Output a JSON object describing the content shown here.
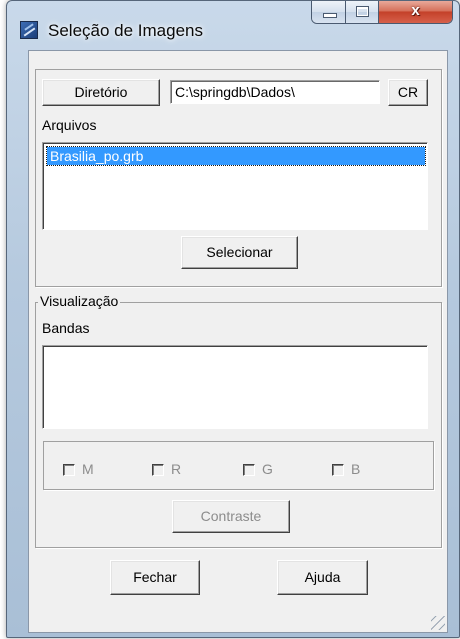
{
  "window": {
    "title": "Seleção de Imagens",
    "close_glyph": "x"
  },
  "directory": {
    "button_label": "Diretório",
    "path_value": "C:\\springdb\\Dados\\",
    "cr_button_label": "CR"
  },
  "files": {
    "label": "Arquivos",
    "items": [
      "Brasilia_po.grb"
    ],
    "selected_index": 0,
    "select_button_label": "Selecionar"
  },
  "visualization": {
    "group_label": "Visualização",
    "bands_label": "Bandas",
    "bands_items": [],
    "channels": [
      {
        "label": "M",
        "checked": false,
        "enabled": false
      },
      {
        "label": "R",
        "checked": false,
        "enabled": false
      },
      {
        "label": "G",
        "checked": false,
        "enabled": false
      },
      {
        "label": "B",
        "checked": false,
        "enabled": false
      }
    ],
    "contrast_button_label": "Contraste",
    "contrast_enabled": false
  },
  "footer": {
    "close_button_label": "Fechar",
    "help_button_label": "Ajuda"
  },
  "colors": {
    "selection_bg": "#3399ff",
    "dialog_bg": "#f0f0f0",
    "close_button_red": "#c4412a"
  },
  "icons": {
    "app": "image-selection-app-icon",
    "minimize": "minimize-icon",
    "maximize": "maximize-icon",
    "close": "close-icon"
  }
}
